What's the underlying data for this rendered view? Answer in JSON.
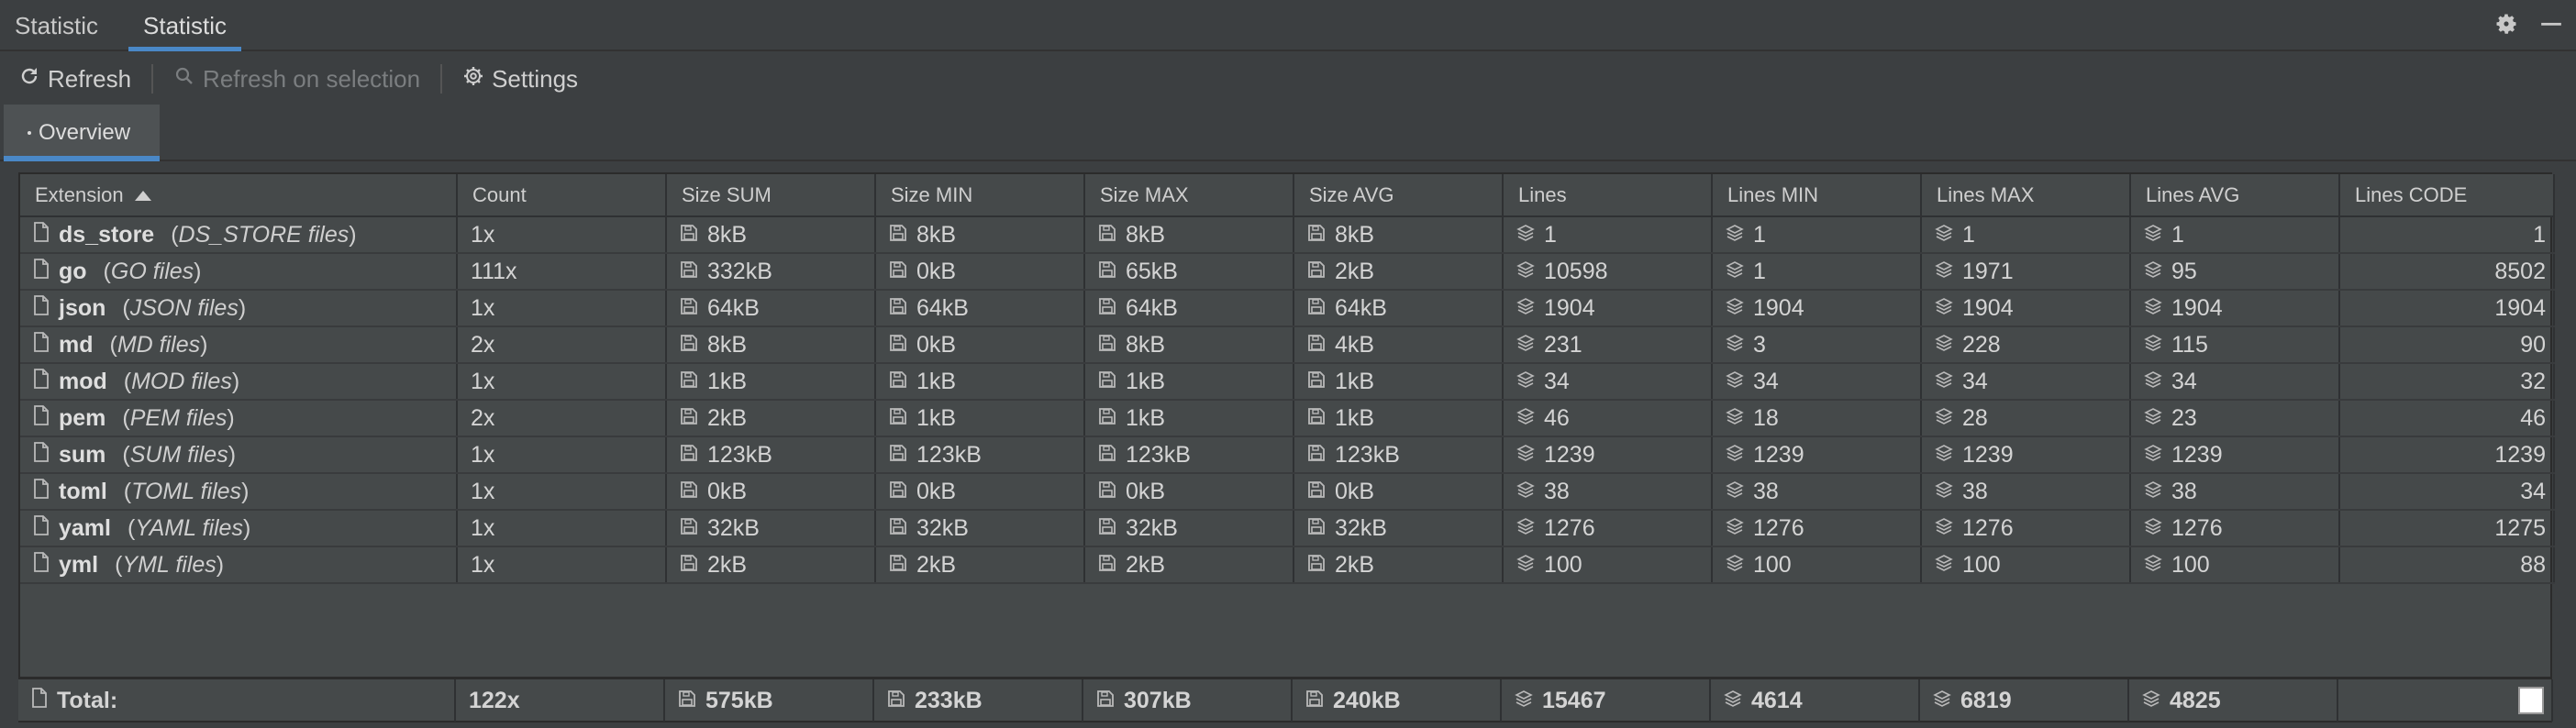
{
  "tool_window": {
    "tabs": [
      "Statistic",
      "Statistic"
    ],
    "active_tab": 1,
    "icons": [
      "gear-icon",
      "minimize-icon"
    ]
  },
  "toolbar": {
    "refresh_label": "Refresh",
    "refresh_selection_label": "Refresh on selection",
    "settings_label": "Settings"
  },
  "subtabs": {
    "overview_label": "Overview"
  },
  "table": {
    "headers": [
      "Extension",
      "Count",
      "Size SUM",
      "Size MIN",
      "Size MAX",
      "Size AVG",
      "Lines",
      "Lines MIN",
      "Lines MAX",
      "Lines AVG",
      "Lines CODE"
    ],
    "sort_column": "Extension",
    "rows": [
      {
        "ext": "ds_store",
        "desc": "DS_STORE files",
        "count": "1x",
        "size_sum": "8kB",
        "size_min": "8kB",
        "size_max": "8kB",
        "size_avg": "8kB",
        "lines": "1",
        "lines_min": "1",
        "lines_max": "1",
        "lines_avg": "1",
        "lines_code": "1"
      },
      {
        "ext": "go",
        "desc": "GO files",
        "count": "111x",
        "size_sum": "332kB",
        "size_min": "0kB",
        "size_max": "65kB",
        "size_avg": "2kB",
        "lines": "10598",
        "lines_min": "1",
        "lines_max": "1971",
        "lines_avg": "95",
        "lines_code": "8502"
      },
      {
        "ext": "json",
        "desc": "JSON files",
        "count": "1x",
        "size_sum": "64kB",
        "size_min": "64kB",
        "size_max": "64kB",
        "size_avg": "64kB",
        "lines": "1904",
        "lines_min": "1904",
        "lines_max": "1904",
        "lines_avg": "1904",
        "lines_code": "1904"
      },
      {
        "ext": "md",
        "desc": "MD files",
        "count": "2x",
        "size_sum": "8kB",
        "size_min": "0kB",
        "size_max": "8kB",
        "size_avg": "4kB",
        "lines": "231",
        "lines_min": "3",
        "lines_max": "228",
        "lines_avg": "115",
        "lines_code": "90"
      },
      {
        "ext": "mod",
        "desc": "MOD files",
        "count": "1x",
        "size_sum": "1kB",
        "size_min": "1kB",
        "size_max": "1kB",
        "size_avg": "1kB",
        "lines": "34",
        "lines_min": "34",
        "lines_max": "34",
        "lines_avg": "34",
        "lines_code": "32"
      },
      {
        "ext": "pem",
        "desc": "PEM files",
        "count": "2x",
        "size_sum": "2kB",
        "size_min": "1kB",
        "size_max": "1kB",
        "size_avg": "1kB",
        "lines": "46",
        "lines_min": "18",
        "lines_max": "28",
        "lines_avg": "23",
        "lines_code": "46"
      },
      {
        "ext": "sum",
        "desc": "SUM files",
        "count": "1x",
        "size_sum": "123kB",
        "size_min": "123kB",
        "size_max": "123kB",
        "size_avg": "123kB",
        "lines": "1239",
        "lines_min": "1239",
        "lines_max": "1239",
        "lines_avg": "1239",
        "lines_code": "1239"
      },
      {
        "ext": "toml",
        "desc": "TOML files",
        "count": "1x",
        "size_sum": "0kB",
        "size_min": "0kB",
        "size_max": "0kB",
        "size_avg": "0kB",
        "lines": "38",
        "lines_min": "38",
        "lines_max": "38",
        "lines_avg": "38",
        "lines_code": "34"
      },
      {
        "ext": "yaml",
        "desc": "YAML files",
        "count": "1x",
        "size_sum": "32kB",
        "size_min": "32kB",
        "size_max": "32kB",
        "size_avg": "32kB",
        "lines": "1276",
        "lines_min": "1276",
        "lines_max": "1276",
        "lines_avg": "1276",
        "lines_code": "1275"
      },
      {
        "ext": "yml",
        "desc": "YML files",
        "count": "1x",
        "size_sum": "2kB",
        "size_min": "2kB",
        "size_max": "2kB",
        "size_avg": "2kB",
        "lines": "100",
        "lines_min": "100",
        "lines_max": "100",
        "lines_avg": "100",
        "lines_code": "88"
      }
    ],
    "total": {
      "label": "Total:",
      "count": "122x",
      "size_sum": "575kB",
      "size_min": "233kB",
      "size_max": "307kB",
      "size_avg": "240kB",
      "lines": "15467",
      "lines_min": "4614",
      "lines_max": "6819",
      "lines_avg": "4825"
    }
  },
  "colors": {
    "background": "#3c3f41",
    "table_bg": "#45494a",
    "accent": "#4a88c7"
  }
}
